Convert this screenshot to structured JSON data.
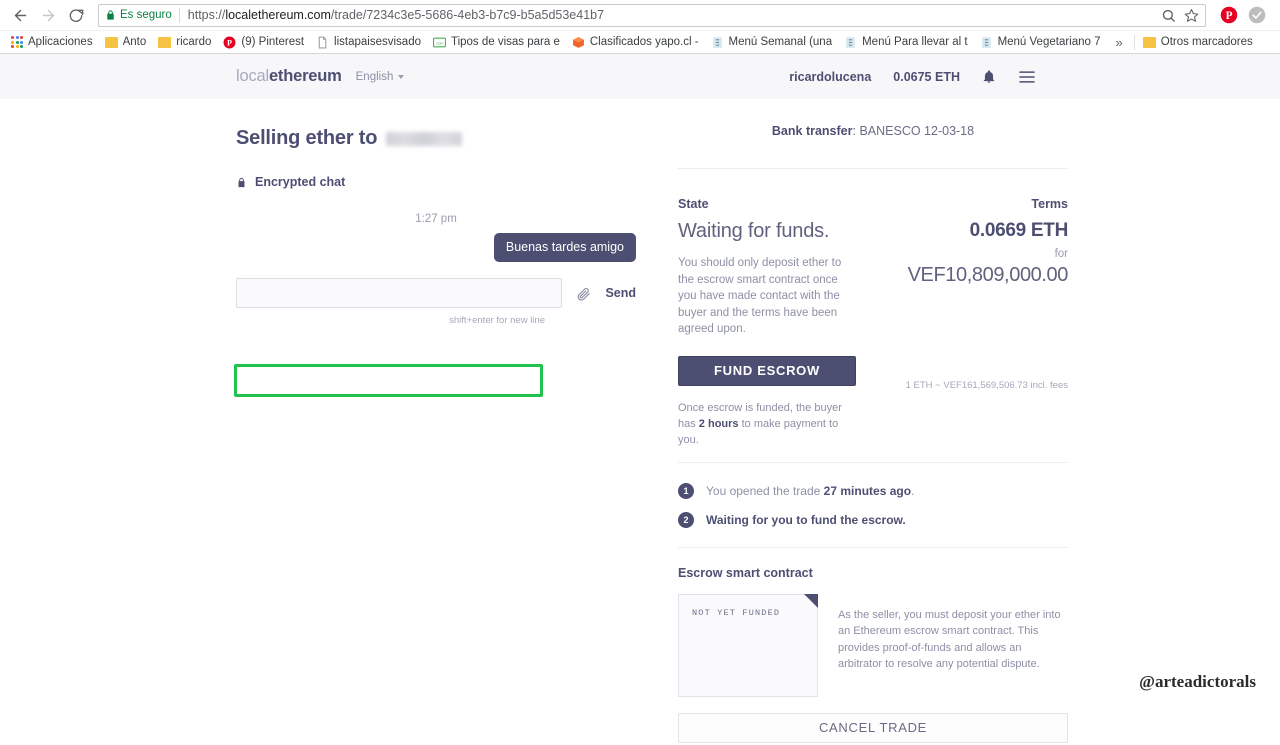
{
  "browser": {
    "back_label": "back-arrow",
    "forward_label": "forward-arrow",
    "reload_label": "reload",
    "security_text": "Es seguro",
    "url_scheme": "https://",
    "url_host": "localethereum.com",
    "url_path": "/trade/7234c3e5-5686-4eb3-b7c9-b5a5d53e41b7",
    "url_full": "https://localethereum.com/trade/7234c3e5-5686-4eb3-b7c9-b5a5d53e41b7",
    "bookmarks": [
      {
        "label": "Aplicaciones",
        "icon": "apps-grid-icon"
      },
      {
        "label": "Anto",
        "icon": "folder-icon"
      },
      {
        "label": "ricardo",
        "icon": "folder-icon"
      },
      {
        "label": "(9) Pinterest",
        "icon": "pinterest-icon"
      },
      {
        "label": "listapaisesvisado",
        "icon": "page-icon"
      },
      {
        "label": "Tipos de visas para e",
        "icon": "site-icon"
      },
      {
        "label": "Clasificados yapo.cl -",
        "icon": "box-icon"
      },
      {
        "label": "Menú Semanal (una ",
        "icon": "doc-icon"
      },
      {
        "label": "Menú Para llevar al t",
        "icon": "doc-icon"
      },
      {
        "label": "Menú Vegetariano 7",
        "icon": "doc-icon"
      }
    ],
    "overflow_label": "»",
    "other_bookmarks_label": "Otros marcadores"
  },
  "site_header": {
    "brand_first": "local",
    "brand_second": "ethereum",
    "language": "English",
    "username": "ricardolucena",
    "balance": "0.0675 ETH"
  },
  "chat": {
    "title_prefix": "Selling ether to",
    "counterparty": "",
    "encrypted_label": "Encrypted chat",
    "timestamp": "1:27 pm",
    "messages": [
      {
        "text": "Buenas tardes amigo",
        "direction": "outgoing"
      }
    ],
    "input_value": "",
    "send_label": "Send",
    "hint": "shift+enter for new line"
  },
  "trade": {
    "payment_method_label": "Bank transfer",
    "payment_method_value": ": BANESCO 12-03-18",
    "state_header": "State",
    "terms_header": "Terms",
    "state_heading": "Waiting for funds.",
    "state_description": "You should only deposit ether to the escrow smart contract once you have made contact with the buyer and the terms have been agreed upon.",
    "fund_escrow_label": "FUND ESCROW",
    "fund_note_prefix": "Once escrow is funded, the buyer has ",
    "fund_note_bold": "2 hours",
    "fund_note_suffix": " to make payment to you.",
    "terms_eth": "0.0669 ETH",
    "terms_for": "for",
    "terms_fiat": "VEF10,809,000.00",
    "terms_rate": "1 ETH ~ VEF161,569,506.73 incl. fees",
    "timeline": [
      {
        "num": "1",
        "text_prefix": "You opened the trade ",
        "text_bold": "27 minutes ago",
        "text_suffix": ".",
        "active": false
      },
      {
        "num": "2",
        "text_prefix": "Waiting for you to fund the escrow.",
        "text_bold": "",
        "text_suffix": "",
        "active": true
      }
    ],
    "escrow_title": "Escrow smart contract",
    "escrow_card_status": "NOT YET FUNDED",
    "escrow_description": "As the seller, you must deposit your ether into an Ethereum escrow smart contract. This provides proof-of-funds and allows an arbitrator to resolve any potential dispute.",
    "cancel_trade_label": "CANCEL TRADE"
  },
  "annotation": {
    "highlight_color": "#1fc24a",
    "watermark": "@arteadictorals"
  },
  "colors": {
    "brand_purple": "#4d4f72",
    "muted": "#8d90a6",
    "secure_green": "#0b8043"
  }
}
